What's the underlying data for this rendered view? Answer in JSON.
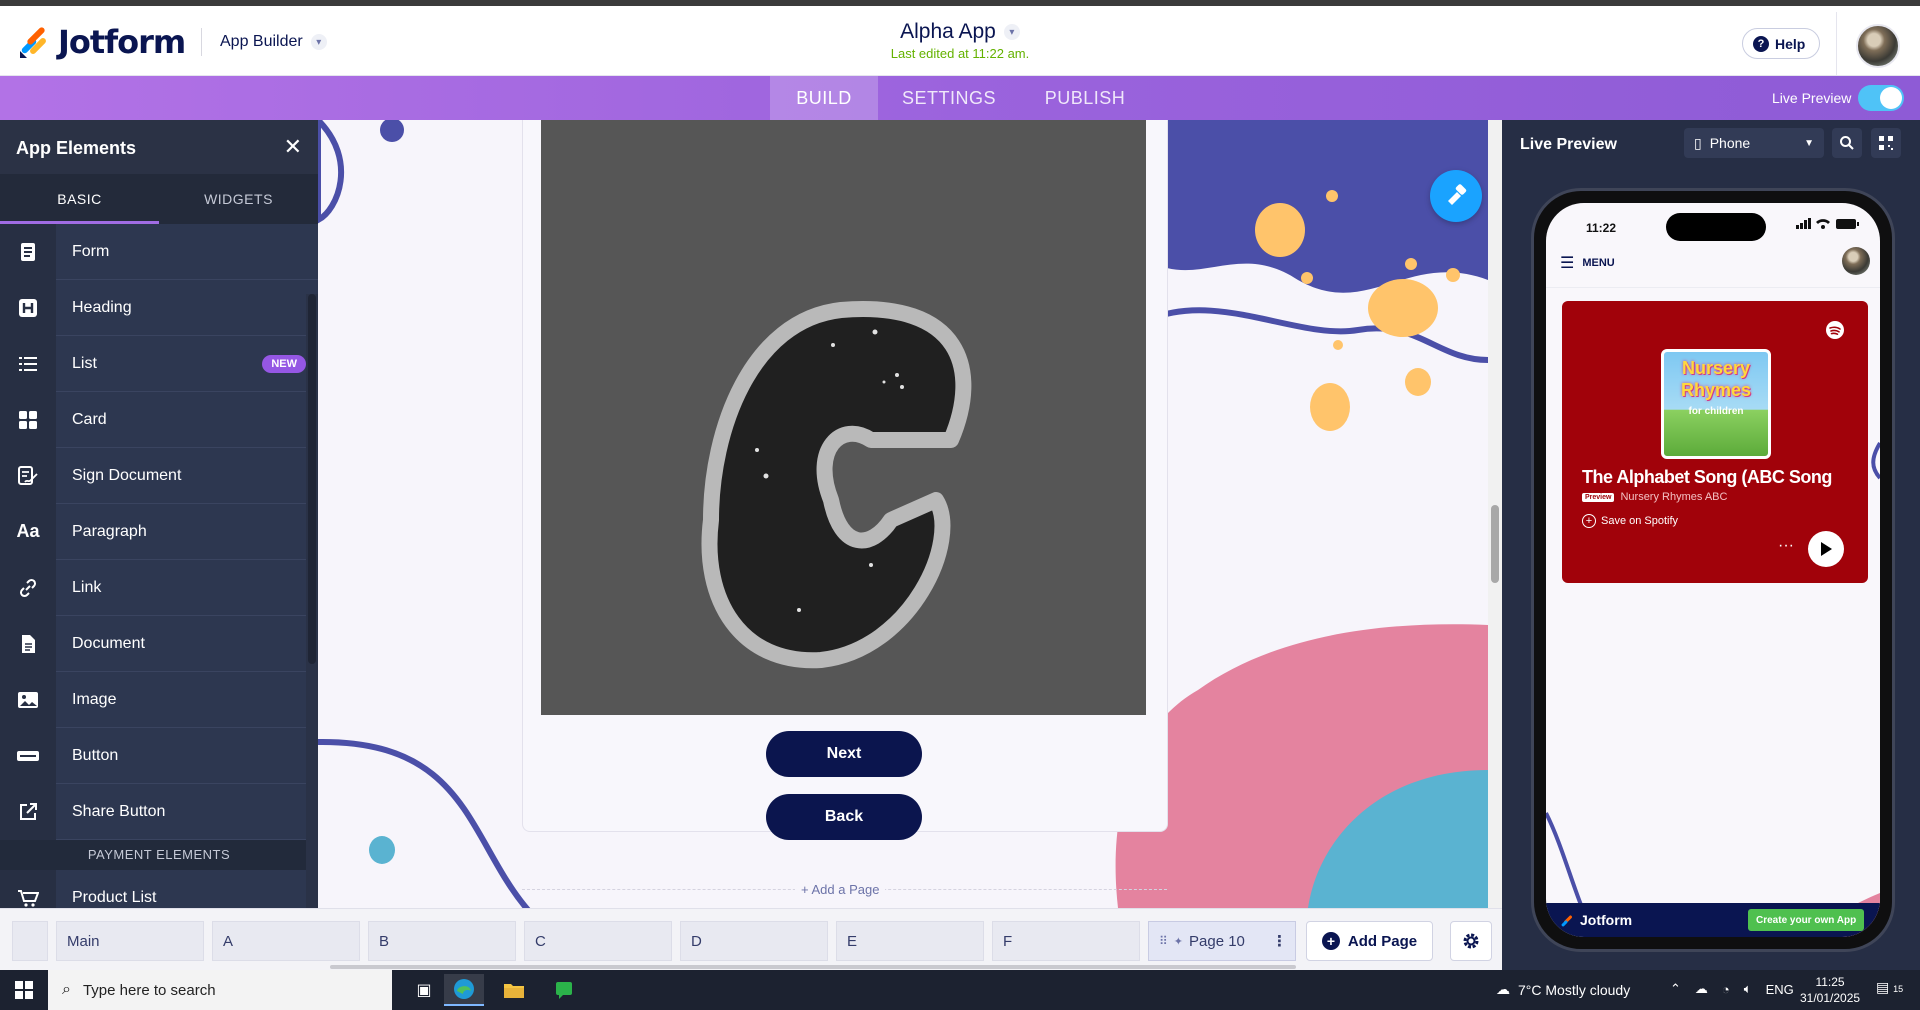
{
  "header": {
    "brand": "Jotform",
    "builder_label": "App Builder",
    "app_title": "Alpha App",
    "last_edited": "Last edited at 11:22 am.",
    "help_label": "Help"
  },
  "nav": {
    "tabs": [
      {
        "label": "BUILD",
        "active": true
      },
      {
        "label": "SETTINGS",
        "active": false
      },
      {
        "label": "PUBLISH",
        "active": false
      }
    ],
    "live_preview_label": "Live Preview",
    "live_preview_on": true
  },
  "sidebar": {
    "title": "App Elements",
    "tabs": [
      {
        "label": "BASIC",
        "active": true
      },
      {
        "label": "WIDGETS",
        "active": false
      }
    ],
    "items": [
      {
        "label": "Form",
        "icon": "form-icon"
      },
      {
        "label": "Heading",
        "icon": "heading-icon"
      },
      {
        "label": "List",
        "icon": "list-icon",
        "badge": "NEW"
      },
      {
        "label": "Card",
        "icon": "card-icon"
      },
      {
        "label": "Sign Document",
        "icon": "sign-document-icon"
      },
      {
        "label": "Paragraph",
        "icon": "paragraph-icon"
      },
      {
        "label": "Link",
        "icon": "link-icon"
      },
      {
        "label": "Document",
        "icon": "document-icon"
      },
      {
        "label": "Image",
        "icon": "image-icon"
      },
      {
        "label": "Button",
        "icon": "button-icon"
      },
      {
        "label": "Share Button",
        "icon": "share-icon"
      }
    ],
    "section_label": "PAYMENT ELEMENTS",
    "payment_items": [
      {
        "label": "Product List",
        "icon": "cart-icon"
      }
    ],
    "paragraph_icon_text": "Aa"
  },
  "canvas": {
    "next_label": "Next",
    "back_label": "Back",
    "add_page_label": "+ Add a Page"
  },
  "pages": {
    "tabs": [
      {
        "label": ""
      },
      {
        "label": "Main"
      },
      {
        "label": "A"
      },
      {
        "label": "B"
      },
      {
        "label": "C"
      },
      {
        "label": "D"
      },
      {
        "label": "E"
      },
      {
        "label": "F"
      },
      {
        "label": "Page 10",
        "active": true
      }
    ],
    "add_page_label": "Add Page"
  },
  "preview": {
    "title": "Live Preview",
    "device": "Phone",
    "phone": {
      "time": "11:22",
      "menu_label": "MENU",
      "spotify": {
        "art_line1": "Nursery",
        "art_line2": "Rhymes",
        "art_line3": "for children",
        "track_title": "The Alphabet Song (ABC Song",
        "preview_badge": "Preview",
        "artist": "Nursery Rhymes ABC",
        "save_label": "Save on Spotify",
        "more": "···"
      },
      "footer_brand": "Jotform",
      "create_label": "Create your own App"
    }
  },
  "taskbar": {
    "search_placeholder": "Type here to search",
    "weather": "7°C  Mostly cloudy",
    "lang": "ENG",
    "time": "11:25",
    "date": "31/01/2025",
    "notif_count": "15"
  },
  "colors": {
    "brand_navy": "#0a1551",
    "nav_purple": "#9b63dd",
    "sidebar_bg": "#2d3750",
    "accent_blue": "#1aa3ff",
    "spotify_red": "#a1020a"
  }
}
